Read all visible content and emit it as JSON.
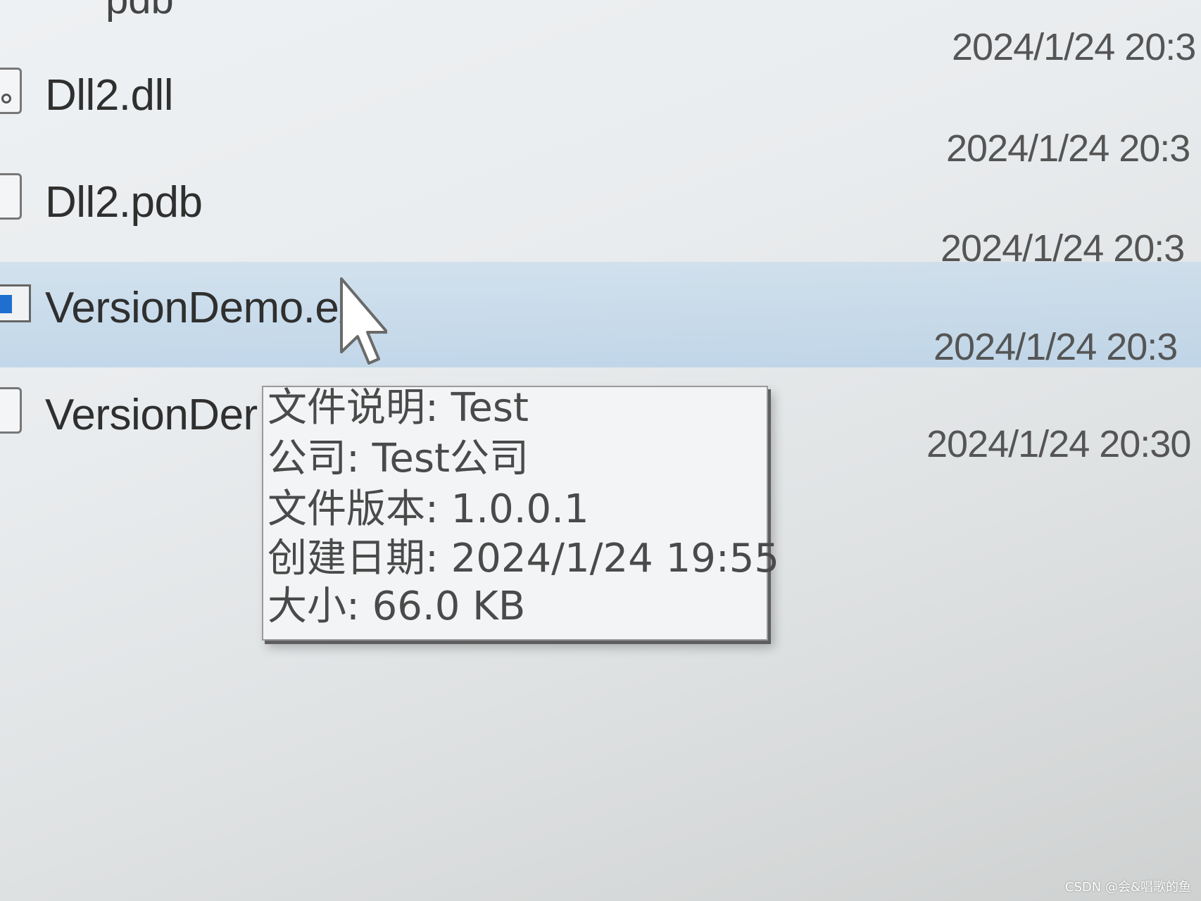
{
  "partial_top_text": "pdb",
  "files": [
    {
      "name": "Dll2.dll",
      "date": "2024/1/24 20:3",
      "icon": "dll-file-icon"
    },
    {
      "name": "Dll2.pdb",
      "date": "2024/1/24 20:3",
      "icon": "file-icon"
    },
    {
      "name": "VersionDemo.ex",
      "date": "2024/1/24 20:3",
      "icon": "exe-icon",
      "selected": true
    },
    {
      "name": "VersionDer",
      "date": "2024/1/24 20:30",
      "icon": "file-icon"
    }
  ],
  "top_date": "2024/1/24 20:3",
  "tooltip": {
    "description": "文件说明: Test",
    "company": "公司: Test公司",
    "file_version": "文件版本: 1.0.0.1",
    "created": "创建日期: 2024/1/24 19:55",
    "size": "大小: 66.0 KB"
  },
  "watermark": "CSDN @会&唱歌的鱼"
}
